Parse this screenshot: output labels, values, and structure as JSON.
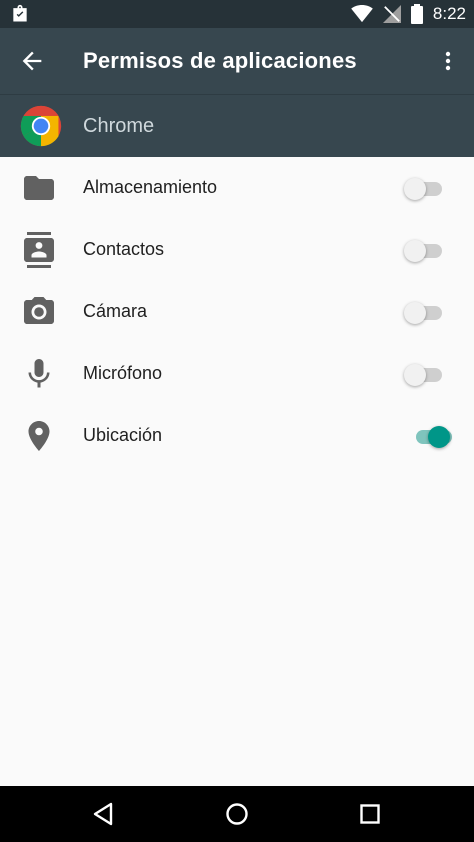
{
  "status_bar": {
    "time": "8:22"
  },
  "app_bar": {
    "title": "Permisos de aplicaciones"
  },
  "app": {
    "name": "Chrome"
  },
  "permissions": [
    {
      "label": "Almacenamiento",
      "enabled": false,
      "icon": "folder-icon"
    },
    {
      "label": "Contactos",
      "enabled": false,
      "icon": "contacts-icon"
    },
    {
      "label": "Cámara",
      "enabled": false,
      "icon": "camera-icon"
    },
    {
      "label": "Micrófono",
      "enabled": false,
      "icon": "microphone-icon"
    },
    {
      "label": "Ubicación",
      "enabled": true,
      "icon": "location-icon"
    }
  ],
  "colors": {
    "status_bar": "#263238",
    "app_bar": "#37474f",
    "switch_on": "#009688",
    "icon_gray": "#616161"
  }
}
